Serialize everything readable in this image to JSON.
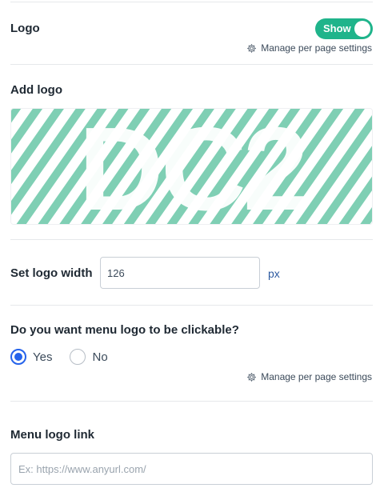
{
  "logo_section": {
    "title": "Logo",
    "toggle_label": "Show",
    "manage_label": "Manage per page settings"
  },
  "add_logo": {
    "title": "Add logo",
    "logo_text": "DC2",
    "pattern_color": "#7fcfb4"
  },
  "logo_width": {
    "label": "Set logo width",
    "value": "126",
    "unit": "px"
  },
  "clickable": {
    "question": "Do you want menu logo to be clickable?",
    "options": [
      "Yes",
      "No"
    ],
    "selected": "Yes",
    "manage_label": "Manage per page settings"
  },
  "menu_link": {
    "title": "Menu logo link",
    "placeholder": "Ex: https://www.anyurl.com/"
  },
  "colors": {
    "toggle_on": "#1fb48b",
    "radio_selected": "#2563eb"
  }
}
